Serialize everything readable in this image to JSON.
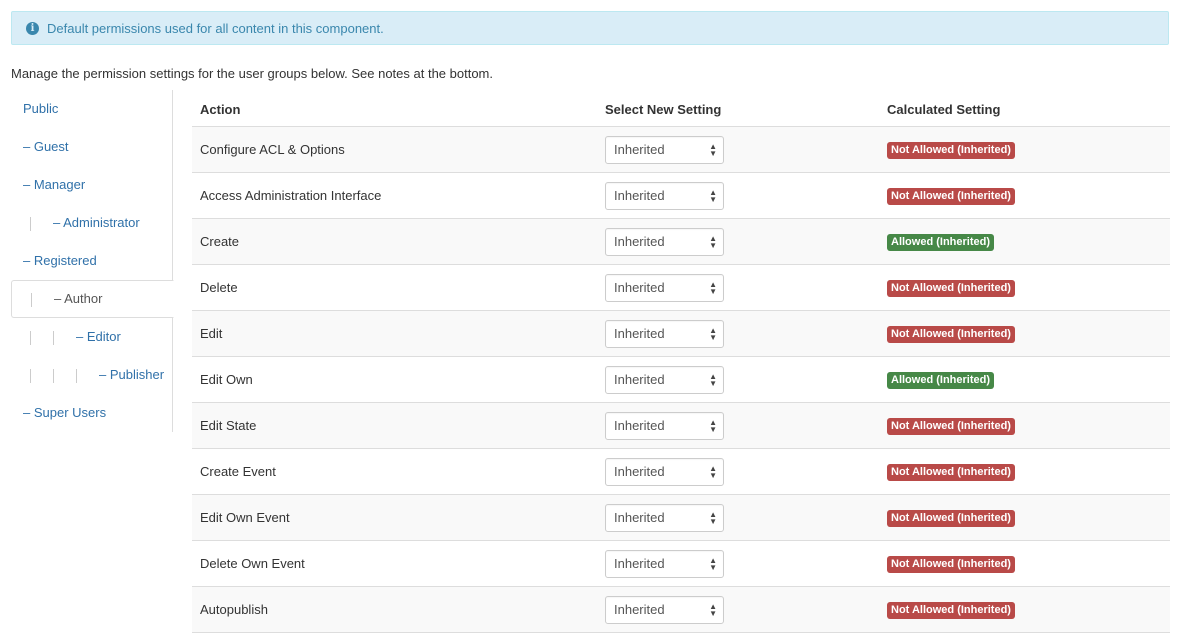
{
  "alert": {
    "icon": "info-icon",
    "text": "Default permissions used for all content in this component."
  },
  "intro": "Manage the permission settings for the user groups below. See notes at the bottom.",
  "groups": [
    {
      "label": "Public",
      "depth": 0,
      "prefix": ""
    },
    {
      "label": "– Guest",
      "depth": 0,
      "prefix": ""
    },
    {
      "label": "– Manager",
      "depth": 0,
      "prefix": ""
    },
    {
      "label": "– Administrator",
      "depth": 1,
      "prefix": ""
    },
    {
      "label": "– Registered",
      "depth": 0,
      "prefix": ""
    },
    {
      "label": "– Author",
      "depth": 1,
      "prefix": "",
      "active": true
    },
    {
      "label": "– Editor",
      "depth": 2,
      "prefix": ""
    },
    {
      "label": "– Publisher",
      "depth": 3,
      "prefix": ""
    },
    {
      "label": "– Super Users",
      "depth": 0,
      "prefix": ""
    }
  ],
  "table": {
    "headers": {
      "action": "Action",
      "select": "Select New Setting",
      "calculated": "Calculated Setting"
    },
    "rows": [
      {
        "action": "Configure ACL & Options",
        "setting": "Inherited",
        "calculated": "Not Allowed (Inherited)",
        "status": "deny"
      },
      {
        "action": "Access Administration Interface",
        "setting": "Inherited",
        "calculated": "Not Allowed (Inherited)",
        "status": "deny"
      },
      {
        "action": "Create",
        "setting": "Inherited",
        "calculated": "Allowed (Inherited)",
        "status": "allow"
      },
      {
        "action": "Delete",
        "setting": "Inherited",
        "calculated": "Not Allowed (Inherited)",
        "status": "deny"
      },
      {
        "action": "Edit",
        "setting": "Inherited",
        "calculated": "Not Allowed (Inherited)",
        "status": "deny"
      },
      {
        "action": "Edit Own",
        "setting": "Inherited",
        "calculated": "Allowed (Inherited)",
        "status": "allow"
      },
      {
        "action": "Edit State",
        "setting": "Inherited",
        "calculated": "Not Allowed (Inherited)",
        "status": "deny"
      },
      {
        "action": "Create Event",
        "setting": "Inherited",
        "calculated": "Not Allowed (Inherited)",
        "status": "deny"
      },
      {
        "action": "Edit Own Event",
        "setting": "Inherited",
        "calculated": "Not Allowed (Inherited)",
        "status": "deny"
      },
      {
        "action": "Delete Own Event",
        "setting": "Inherited",
        "calculated": "Not Allowed (Inherited)",
        "status": "deny"
      },
      {
        "action": "Autopublish",
        "setting": "Inherited",
        "calculated": "Not Allowed (Inherited)",
        "status": "deny"
      }
    ]
  },
  "colors": {
    "alert_bg": "#d9edf7",
    "alert_text": "#3a87ad",
    "link": "#3071a9",
    "deny": "#b94a48",
    "allow": "#468847"
  }
}
